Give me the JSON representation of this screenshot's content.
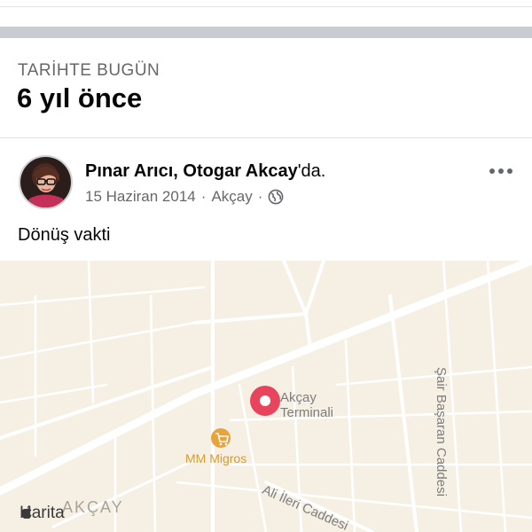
{
  "memories": {
    "section_label": "TARİHTE BUGÜN",
    "years_ago": "6 yıl önce"
  },
  "post": {
    "author_name": "Pınar Arıcı",
    "separator": ", ",
    "place_name": "Otogar Akcay",
    "place_suffix": "'da.",
    "date": "15 Haziran 2014",
    "location": "Akçay",
    "privacy_icon": "globe-icon",
    "more_icon": "more-options-icon",
    "text": "Dönüş vakti"
  },
  "map": {
    "pin_label_line1": "Akçay",
    "pin_label_line2": "Terminali",
    "poi_label": "MM Migros",
    "street_label": "Ali İleri Caddesi",
    "avenue_label": "Şair Başaran Caddesi",
    "area_label": "AKÇAY",
    "attribution": "Harita",
    "colors": {
      "background": "#f6f0e4",
      "road": "#ffffff",
      "pin": "#e8445c",
      "poi": "#e8a33a"
    }
  }
}
